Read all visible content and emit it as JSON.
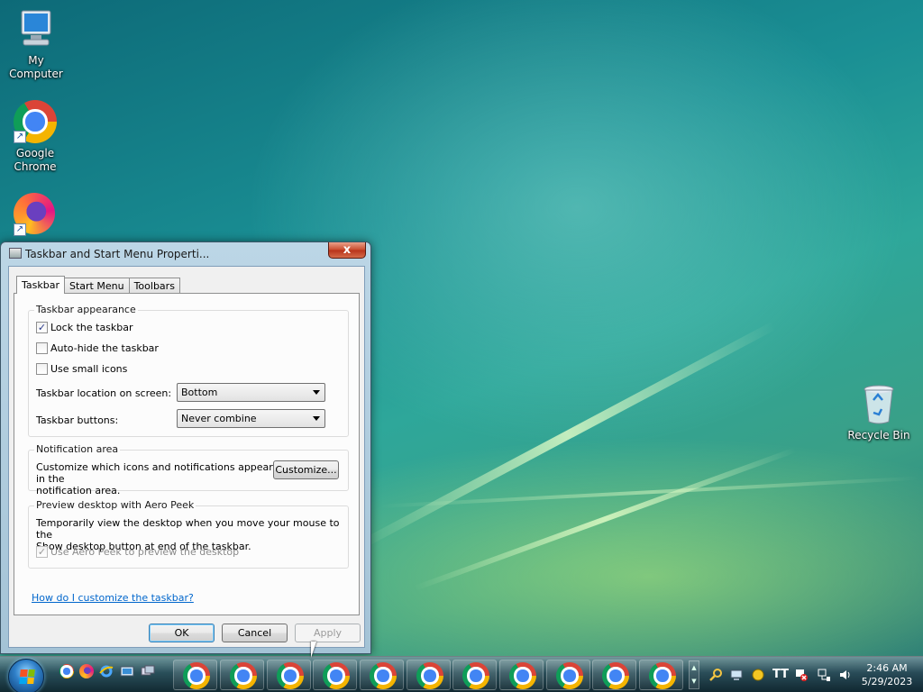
{
  "desktop": {
    "icons": [
      {
        "label": "My Computer"
      },
      {
        "label": "Google Chrome"
      },
      {
        "label": ""
      },
      {
        "label": "Recycle Bin"
      }
    ]
  },
  "dialog": {
    "title": "Taskbar and Start Menu Properti...",
    "close_glyph": "x",
    "tabs": [
      {
        "label": "Taskbar",
        "active": true
      },
      {
        "label": "Start Menu",
        "active": false
      },
      {
        "label": "Toolbars",
        "active": false
      }
    ],
    "appearance": {
      "title": "Taskbar appearance",
      "lock_taskbar": {
        "label": "Lock the taskbar",
        "checked": true
      },
      "auto_hide": {
        "label": "Auto-hide the taskbar",
        "checked": false
      },
      "small_icons": {
        "label": "Use small icons",
        "checked": false
      },
      "location_label": "Taskbar location on screen:",
      "location_value": "Bottom",
      "buttons_label": "Taskbar buttons:",
      "buttons_value": "Never combine"
    },
    "notification": {
      "title": "Notification area",
      "description_line1": "Customize which icons and notifications appear in the",
      "description_line2": "notification area.",
      "customize_label": "Customize..."
    },
    "aero_peek": {
      "title": "Preview desktop with Aero Peek",
      "description_line1": "Temporarily view the desktop when you move your mouse to the",
      "description_line2": "Show desktop button at end of the taskbar.",
      "use_aero_peek": {
        "label": "Use Aero Peek to preview the desktop",
        "checked": true,
        "disabled": true
      }
    },
    "help_link": "How do I customize the taskbar?",
    "ok_label": "OK",
    "cancel_label": "Cancel",
    "apply_label": "Apply",
    "check_glyph": "✓"
  },
  "taskbar": {
    "task_button_count": 11,
    "clock_time": "2:46 AM",
    "clock_date": "5/29/2023",
    "tray_text_icon": "TT",
    "scroll_up": "▲",
    "scroll_down": "▼"
  },
  "colors": {
    "link": "#0066cc",
    "close_button": "#c94a2c"
  }
}
